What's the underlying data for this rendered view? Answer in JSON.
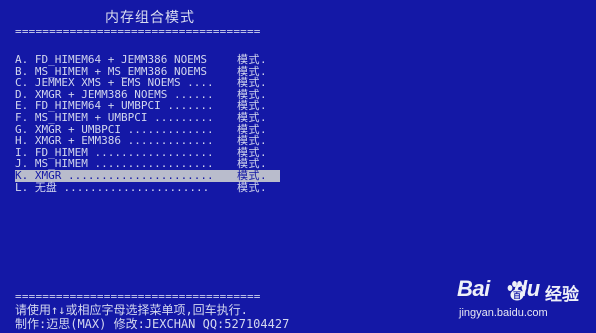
{
  "title": "内存组合模式",
  "rule_top": "====================================",
  "rule_bottom": "====================================",
  "menu": {
    "items": [
      {
        "label": "A. FD_HIMEM64 + JEMM386 NOEMS",
        "mode": "模式."
      },
      {
        "label": "B. MS_HIMEM + MS_EMM386 NOEMS",
        "mode": "模式."
      },
      {
        "label": "C. JEMMEX XMS + EMS NOEMS ....",
        "mode": "模式."
      },
      {
        "label": "D. XMGR + JEMM386 NOEMS ......",
        "mode": "模式."
      },
      {
        "label": "E. FD_HIMEM64 + UMBPCI .......",
        "mode": "模式."
      },
      {
        "label": "F. MS_HIMEM + UMBPCI .........",
        "mode": "模式."
      },
      {
        "label": "G. XMGR + UMBPCI .............",
        "mode": "模式."
      },
      {
        "label": "H. XMGR + EMM386 .............",
        "mode": "模式."
      },
      {
        "label": "I. FD_HIMEM ..................",
        "mode": "模式."
      },
      {
        "label": "J. MS_HIMEM ..................",
        "mode": "模式."
      },
      {
        "label": "K. XMGR ......................",
        "mode": "模式."
      },
      {
        "label": "L. 无盘 ......................",
        "mode": "模式."
      }
    ],
    "selected_index": 10
  },
  "footer": {
    "hint": "请使用↑↓或相应字母选择菜单项,回车执行.",
    "credit": "制作:迈思(MAX) 修改:JEXCHAN QQ:527104427"
  },
  "watermark": {
    "logo_left": "Bai",
    "logo_right": "百",
    "logo_suffix": "du",
    "jingyan": "经验",
    "url": "jingyan.baidu.com"
  },
  "colors": {
    "background": "#1418a6",
    "text": "#d2d6ee",
    "highlight_bg": "#b9bccc"
  }
}
